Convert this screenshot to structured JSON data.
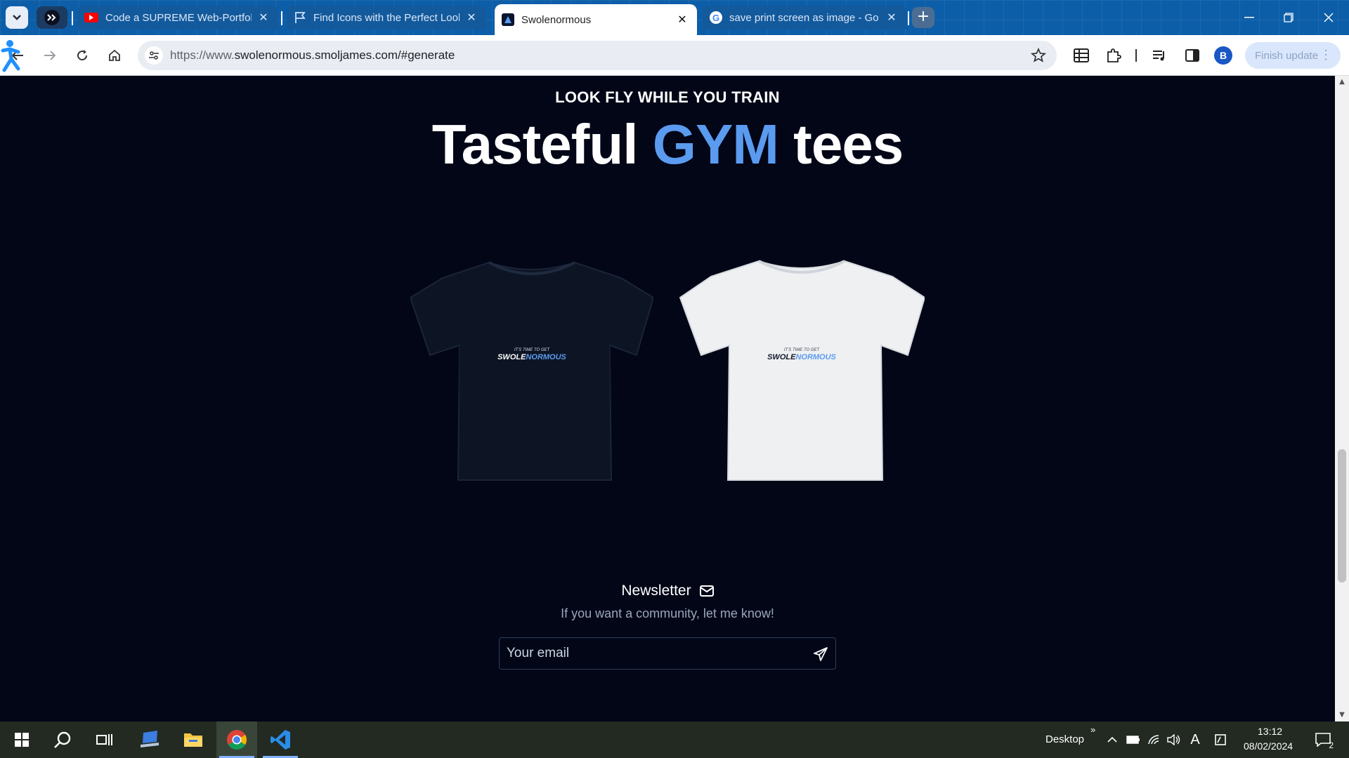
{
  "browser": {
    "tabs": [
      {
        "title": "Code a SUPREME Web-Portfolio",
        "icon": "youtube-icon",
        "active": false
      },
      {
        "title": "Find Icons with the Perfect Look",
        "icon": "flag-icon",
        "active": false
      },
      {
        "title": "Swolenormous",
        "icon": "swolenormous-favicon",
        "active": true
      },
      {
        "title": "save print screen as image - Go",
        "icon": "google-icon",
        "active": false
      }
    ],
    "url_prefix": "https://www.",
    "url_rest": "swolenormous.smoljames.com/#generate",
    "profile_initial": "B",
    "finish_update_label": "Finish update"
  },
  "page": {
    "eyebrow": "LOOK FLY WHILE YOU TRAIN",
    "headline_before": "Tasteful ",
    "headline_accent": "GYM",
    "headline_after": " tees",
    "accent_color": "#5a9bf0",
    "tees": [
      {
        "color": "dark",
        "print_top": "IT'S TIME TO GET",
        "print_brand_a": "SWOLE",
        "print_brand_b": "NORMOUS"
      },
      {
        "color": "white",
        "print_top": "IT'S TIME TO GET",
        "print_brand_a": "SWOLE",
        "print_brand_b": "NORMOUS"
      }
    ],
    "newsletter": {
      "title": "Newsletter",
      "subtitle": "If you want a community, let me know!",
      "email_placeholder": "Your email"
    }
  },
  "taskbar": {
    "desktop_label": "Desktop",
    "chevron": "»",
    "ime_label": "A",
    "time": "13:12",
    "date": "08/02/2024",
    "notification_count": "2"
  }
}
